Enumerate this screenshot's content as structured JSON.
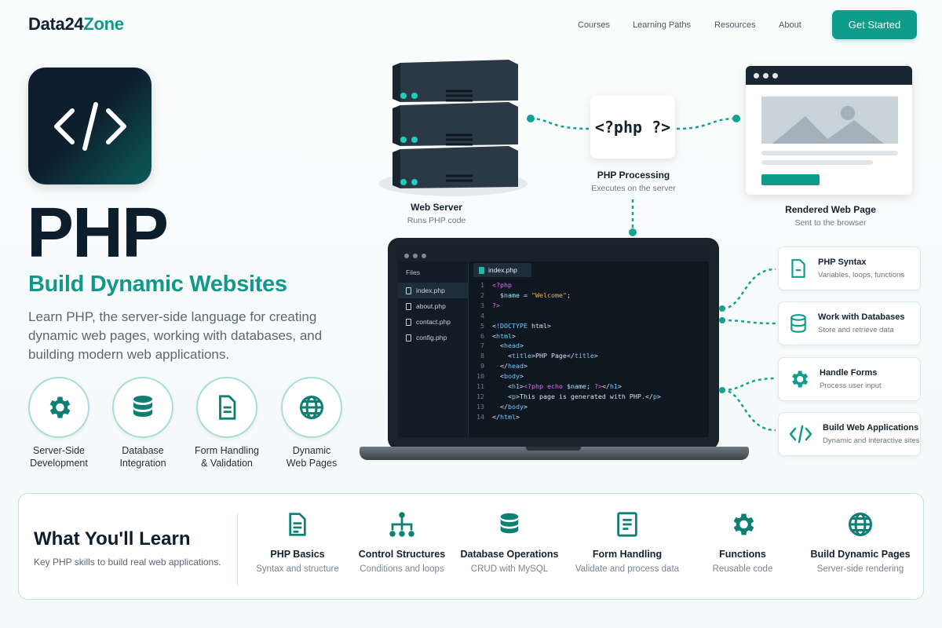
{
  "nav": {
    "brand_part1": "Data24",
    "brand_part2": "Zone",
    "links": [
      "Courses",
      "Learning Paths",
      "Resources",
      "About"
    ],
    "cta_label": "Get Started"
  },
  "hero": {
    "icon": "code-brackets-icon",
    "title": "PHP",
    "subtitle": "Build Dynamic Websites",
    "description": "Learn PHP, the server-side language for creating dynamic web pages, working with databases, and building modern web applications.",
    "features": [
      {
        "icon": "gear-icon",
        "label": "Server-Side\nDevelopment"
      },
      {
        "icon": "database-icon",
        "label": "Database\nIntegration"
      },
      {
        "icon": "document-icon",
        "label": "Form Handling\n& Validation"
      },
      {
        "icon": "globe-icon",
        "label": "Dynamic\nWeb Pages"
      }
    ]
  },
  "diagram": {
    "server": {
      "title": "Web Server",
      "subtitle": "Runs PHP code"
    },
    "processing": {
      "code": "<?php ?>",
      "title": "PHP Processing",
      "subtitle": "Executes on the server"
    },
    "rendered": {
      "title": "Rendered Web Page",
      "subtitle": "Sent to the browser"
    }
  },
  "editor": {
    "files_header": "Files",
    "files": [
      "index.php",
      "about.php",
      "contact.php",
      "config.php"
    ],
    "active_tab": "index.php",
    "lines": [
      "<?php",
      "  $name = \"Welcome\";",
      "?>",
      "",
      "<!DOCTYPE html>",
      "<html>",
      "  <head>",
      "    <title>PHP Page</title>",
      "  </head>",
      "  <body>",
      "    <h1><?php echo $name; ?></h1>",
      "    <p>This page is generated with PHP.</p>",
      "  </body>",
      "</html>"
    ]
  },
  "skills": [
    {
      "icon": "document-icon",
      "title": "PHP Syntax",
      "subtitle": "Variables, loops, functions"
    },
    {
      "icon": "database-icon",
      "title": "Work with Databases",
      "subtitle": "Store and retrieve data"
    },
    {
      "icon": "gear-icon",
      "title": "Handle Forms",
      "subtitle": "Process user input"
    },
    {
      "icon": "code-brackets-icon",
      "title": "Build Web Applications",
      "subtitle": "Dynamic and interactive sites"
    }
  ],
  "learn": {
    "title": "What You'll Learn",
    "subtitle": "Key PHP skills to build real web applications.",
    "items": [
      {
        "icon": "document-icon",
        "title": "PHP Basics",
        "subtitle": "Syntax and structure"
      },
      {
        "icon": "flowchart-icon",
        "title": "Control Structures",
        "subtitle": "Conditions and loops"
      },
      {
        "icon": "database-icon",
        "title": "Database Operations",
        "subtitle": "CRUD with MySQL"
      },
      {
        "icon": "form-icon",
        "title": "Form Handling",
        "subtitle": "Validate and process data"
      },
      {
        "icon": "gear-icon",
        "title": "Functions",
        "subtitle": "Reusable code"
      },
      {
        "icon": "globe-icon",
        "title": "Build Dynamic Pages",
        "subtitle": "Server-side rendering"
      }
    ]
  },
  "colors": {
    "accent": "#0f9d8b",
    "dark": "#0c1d2c",
    "editor_bg": "#0f1821"
  }
}
